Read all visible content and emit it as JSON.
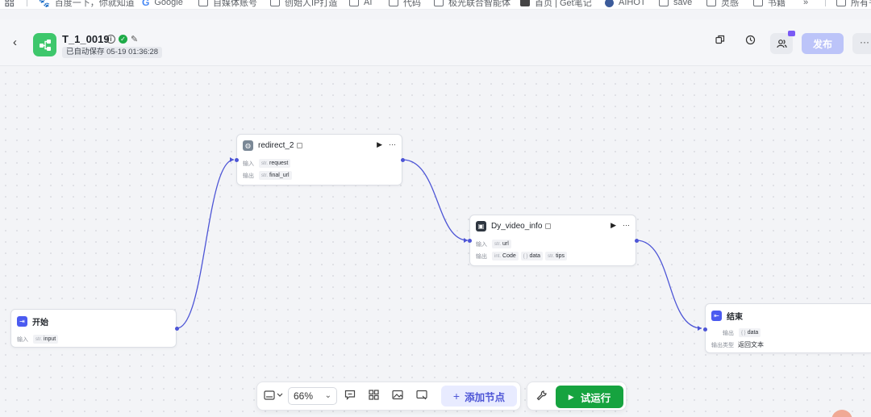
{
  "bookmarks": [
    {
      "label": "百度一下，你就知道",
      "icon": "baidu-icon"
    },
    {
      "label": "Google",
      "icon": "google-icon"
    },
    {
      "label": "自媒体账号",
      "icon": "folder-icon"
    },
    {
      "label": "创始人IP打造",
      "icon": "folder-icon"
    },
    {
      "label": "AI",
      "icon": "folder-icon"
    },
    {
      "label": "代码",
      "icon": "folder-icon"
    },
    {
      "label": "极光联合智能体",
      "icon": "folder-icon"
    },
    {
      "label": "首页 | Get笔记",
      "icon": "getnote-icon"
    },
    {
      "label": "AIHOT",
      "icon": "aihot-icon"
    },
    {
      "label": "save",
      "icon": "folder-icon"
    },
    {
      "label": "灵感",
      "icon": "folder-icon"
    },
    {
      "label": "书籍",
      "icon": "folder-icon"
    },
    {
      "label": "所有书签",
      "icon": "folder-icon"
    }
  ],
  "header": {
    "title": "T_1_0019",
    "saved_status": "已自动保存 05-19 01:36:28",
    "publish_label": "发布",
    "more_label": "···"
  },
  "nodes": {
    "start": {
      "title": "开始",
      "input_label": "输入",
      "inputs": [
        {
          "type": "str.",
          "name": "input"
        }
      ]
    },
    "redirect": {
      "title": "redirect_2",
      "input_label": "输入",
      "output_label": "输出",
      "inputs": [
        {
          "type": "str.",
          "name": "request"
        }
      ],
      "outputs": [
        {
          "type": "str.",
          "name": "final_url"
        }
      ]
    },
    "video": {
      "title": "Dy_video_info",
      "input_label": "输入",
      "output_label": "输出",
      "inputs": [
        {
          "type": "str.",
          "name": "url"
        }
      ],
      "outputs": [
        {
          "type": "int.",
          "name": "Code"
        },
        {
          "type": "{ }",
          "name": "data"
        },
        {
          "type": "str.",
          "name": "tips"
        }
      ]
    },
    "end": {
      "title": "结束",
      "output_label": "输出",
      "outputs": [
        {
          "type": "{ }",
          "name": "data"
        }
      ],
      "output_type_label": "输出类型",
      "output_type_value": "返回文本"
    }
  },
  "toolbar": {
    "zoom": "66%",
    "add_node_label": "添加节点",
    "run_label": "试运行"
  },
  "colors": {
    "accent": "#4d55d6",
    "publish_disabled": "#bcc4f9",
    "run_green": "#16a33f",
    "app_icon_green": "#3ec76c"
  }
}
